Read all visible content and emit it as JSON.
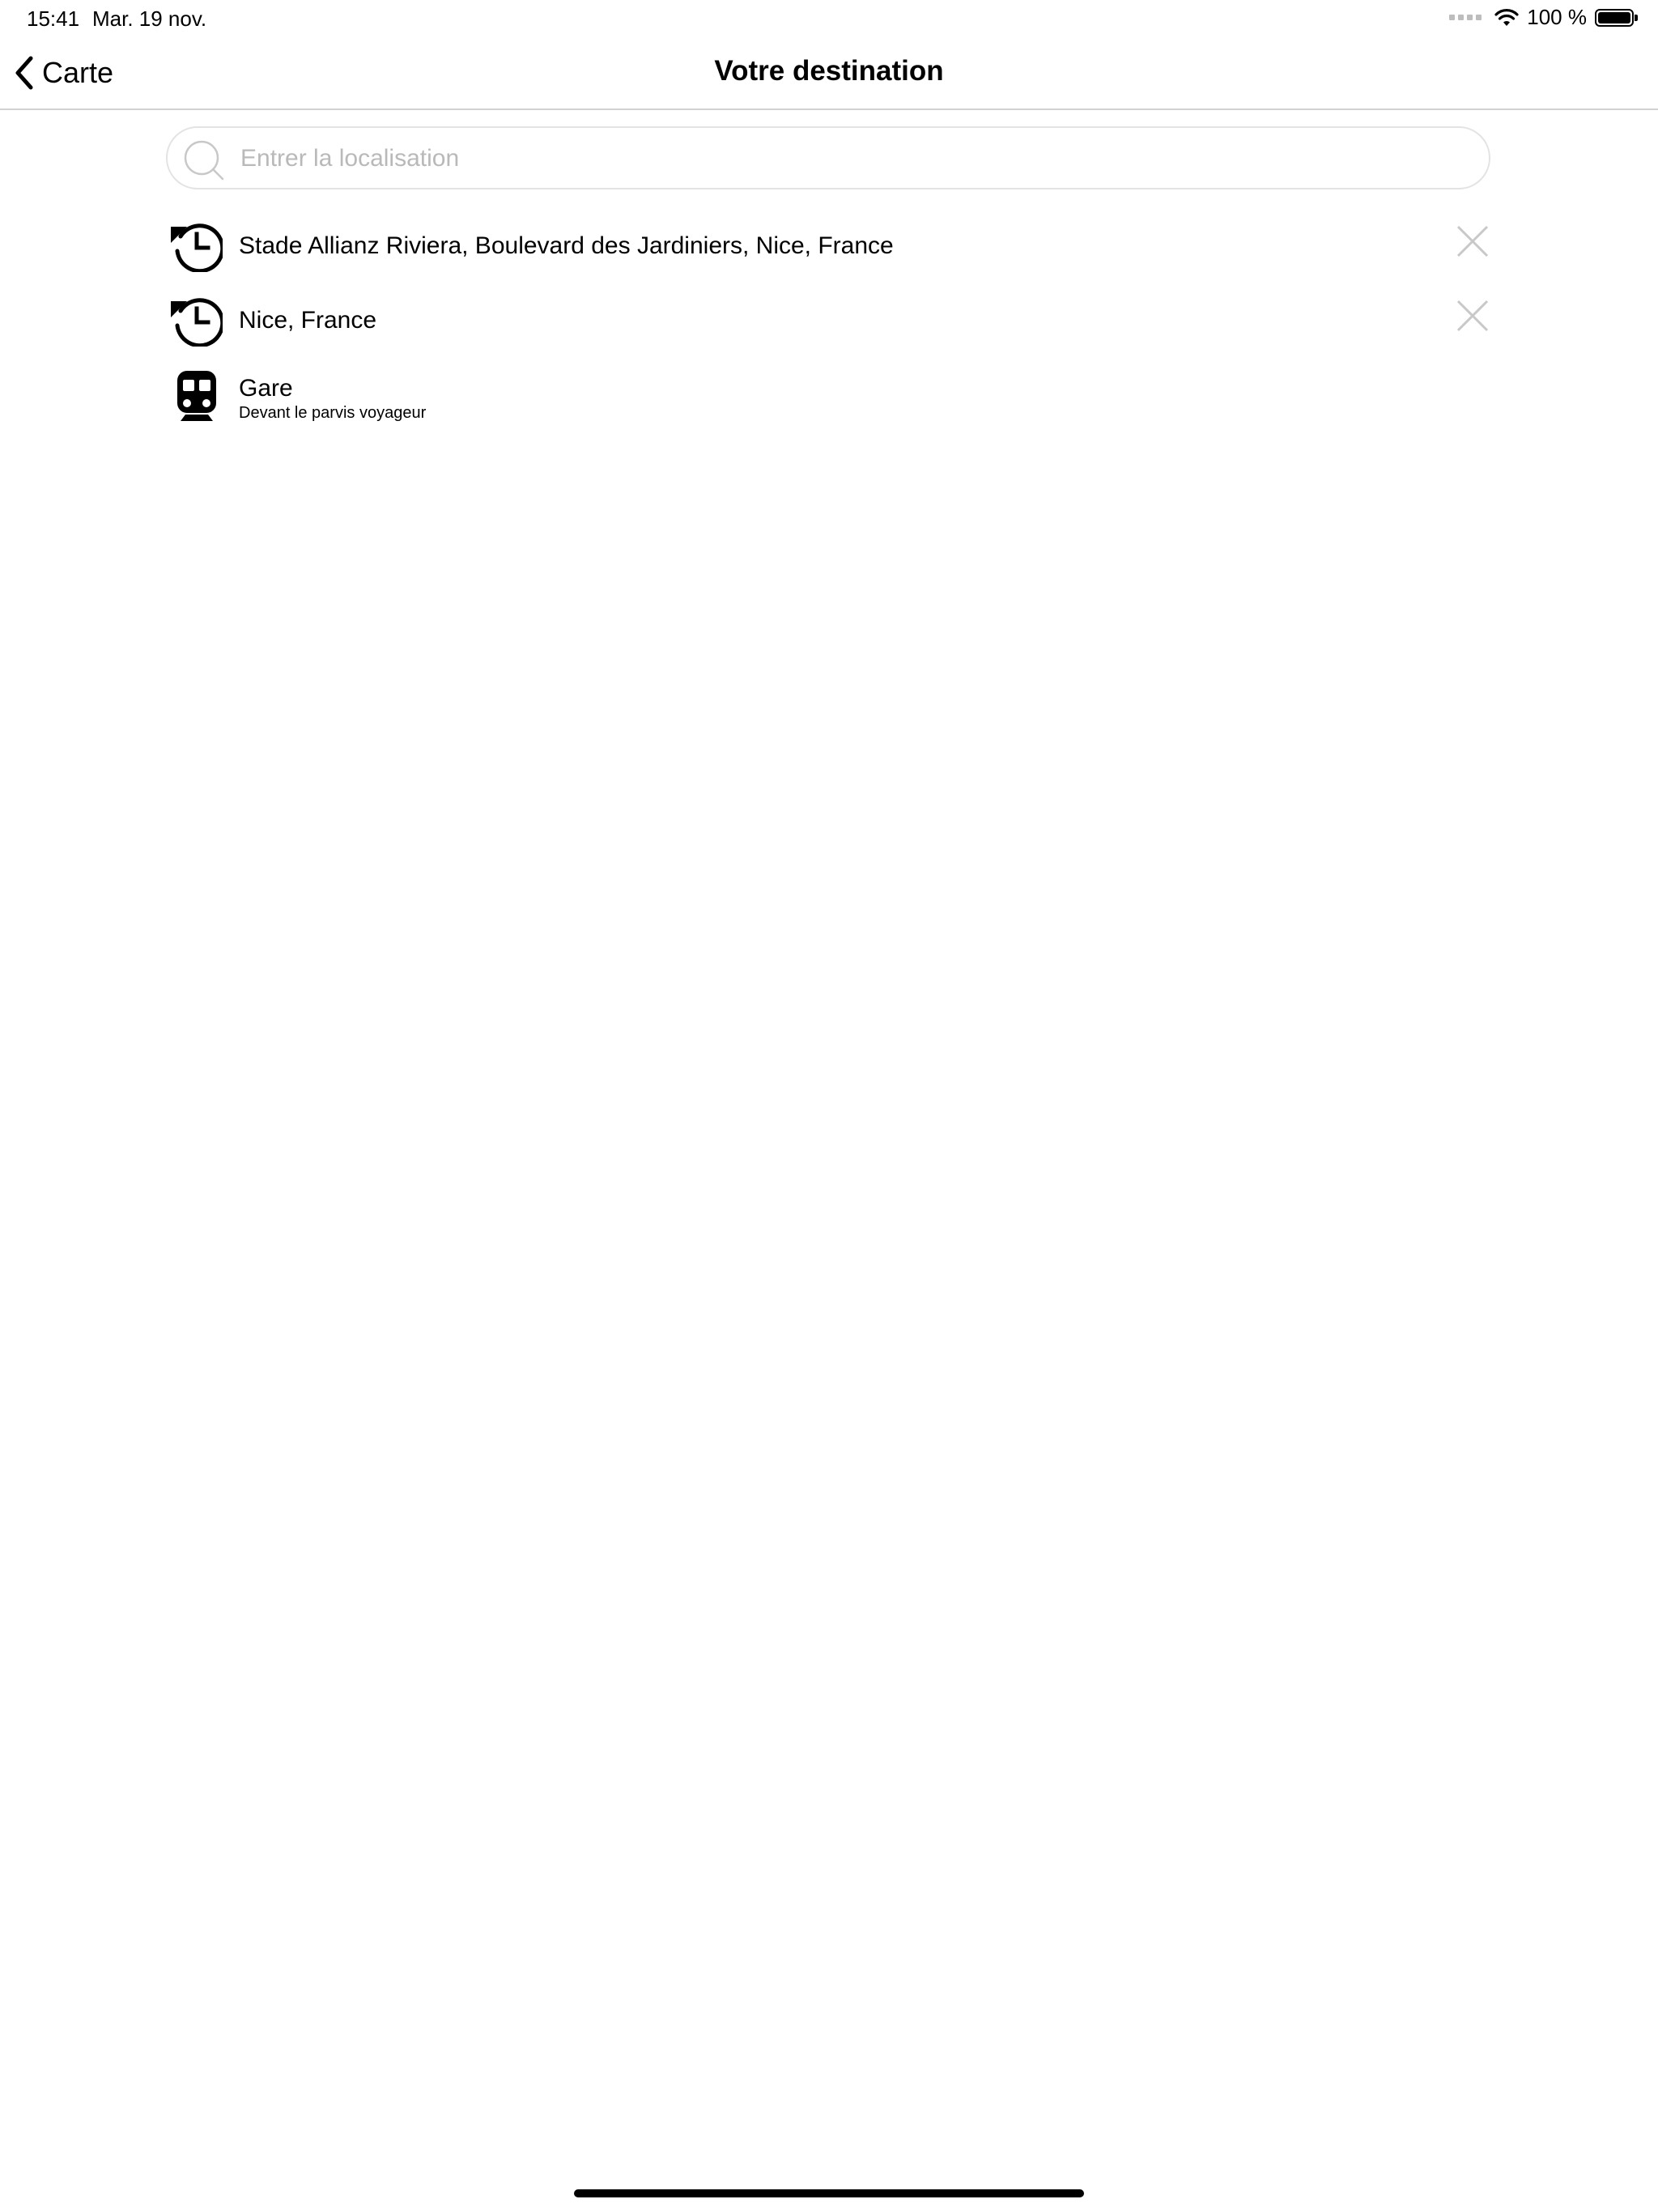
{
  "status_bar": {
    "time": "15:41",
    "date": "Mar. 19 nov.",
    "battery": "100 %",
    "battery_level_percent": 100,
    "icons": [
      "cellular-icon",
      "wifi-icon",
      "battery-icon"
    ]
  },
  "nav_bar": {
    "back_label": "Carte",
    "title": "Votre destination"
  },
  "search": {
    "placeholder": "Entrer la localisation",
    "value": ""
  },
  "results": [
    {
      "icon": "history-icon",
      "title": "Stade Allianz Riviera, Boulevard des Jardiniers, Nice, France",
      "removable": true
    },
    {
      "icon": "history-icon",
      "title": "Nice, France",
      "removable": true
    },
    {
      "icon": "train-icon",
      "title": "Gare",
      "subtitle": "Devant le parvis voyageur",
      "removable": false
    }
  ],
  "colors": {
    "text": "#000000",
    "placeholder": "#b9b9b9",
    "divider": "#d1d1d1",
    "remove_icon": "#c8c8c8"
  }
}
